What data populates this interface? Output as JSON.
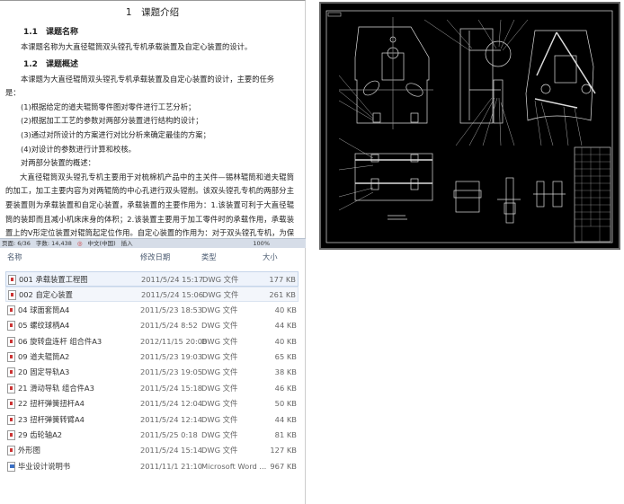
{
  "document": {
    "h1": "1　课题介绍",
    "h2a": "1.1　课题名称",
    "p_name": "本课题名称为大直径辊筒双头镗孔专机承载装置及自定心装置的设计。",
    "h2b": "1.2　课题概述",
    "p_intro1": "本课题为大直径辊筒双头镗孔专机承载装置及自定心装置的设计，主要的任务",
    "p_intro2": "是：",
    "tasks": [
      "(1)根据给定的道夫辊筒零件图对零件进行工艺分析；",
      "(2)根据加工工艺的参数对两部分装置进行结构的设计；",
      "(3)通过对所设计的方案进行对比分析来确定最佳的方案；",
      "(4)对设计的参数进行计算和校核。"
    ],
    "p_overview": "对两部分装置的概述：",
    "p_body": "大直径辊筒双头镗孔专机主要用于对梳棉机产品中的主关件—锡林辊筒和道夫辊筒的加工，加工主要内容为对两辊筒的中心孔进行双头镗削。该双头镗孔专机的两部分主要装置则为承载装置和自定心装置，承载装置的主要作用为：1.该装置可利于大直径辊筒的装卸而且减小机床床身的体积；2.该装置主要用于加工零件时的承载作用，承载装置上的V形定位装置对辊筒起定位作用。自定心装置的作用为：对于双头镗孔专机，为保证镗孔的精度和辊筒两端孔的同轴度就必须保证在加工时"
  },
  "statusbar": {
    "page": "页面: 6/36",
    "words": "字数: 14,438",
    "lang": "中文(中国)",
    "mode": "插入",
    "zoom": "100%"
  },
  "explorer": {
    "columns": {
      "name": "名称",
      "date": "修改日期",
      "type": "类型",
      "size": "大小"
    },
    "files": [
      {
        "name": "001 承载装置工程图",
        "date": "2011/5/24 15:17",
        "type": "DWG 文件",
        "size": "177 KB",
        "icon": "dwg-file-icon"
      },
      {
        "name": "002 自定心装置",
        "date": "2011/5/24 15:06",
        "type": "DWG 文件",
        "size": "261 KB",
        "icon": "dwg-file-icon"
      },
      {
        "name": "04 球面套筒A4",
        "date": "2011/5/23 18:53",
        "type": "DWG 文件",
        "size": "40 KB",
        "icon": "dwg-file-icon"
      },
      {
        "name": "05 螺纹球柄A4",
        "date": "2011/5/24 8:52",
        "type": "DWG 文件",
        "size": "44 KB",
        "icon": "dwg-file-icon"
      },
      {
        "name": "06 旋转盘连杆 组合件A3",
        "date": "2012/11/15 20:08",
        "type": "DWG 文件",
        "size": "40 KB",
        "icon": "dwg-file-icon"
      },
      {
        "name": "09 道夫辊筒A2",
        "date": "2011/5/23 19:03",
        "type": "DWG 文件",
        "size": "65 KB",
        "icon": "dwg-file-icon"
      },
      {
        "name": "20 固定导轨A3",
        "date": "2011/5/23 19:05",
        "type": "DWG 文件",
        "size": "38 KB",
        "icon": "dwg-file-icon"
      },
      {
        "name": "21 滑动导轨 组合件A3",
        "date": "2011/5/24 15:18",
        "type": "DWG 文件",
        "size": "46 KB",
        "icon": "dwg-file-icon"
      },
      {
        "name": "22 扭杆弹簧扭杆A4",
        "date": "2011/5/24 12:04",
        "type": "DWG 文件",
        "size": "50 KB",
        "icon": "dwg-file-icon"
      },
      {
        "name": "23 扭杆弹簧转臂A4",
        "date": "2011/5/24 12:14",
        "type": "DWG 文件",
        "size": "44 KB",
        "icon": "dwg-file-icon"
      },
      {
        "name": "29 齿轮轴A2",
        "date": "2011/5/25 0:18",
        "type": "DWG 文件",
        "size": "81 KB",
        "icon": "dwg-file-icon"
      },
      {
        "name": "外形图",
        "date": "2011/5/24 15:14",
        "type": "DWG 文件",
        "size": "127 KB",
        "icon": "dwg-file-icon"
      },
      {
        "name": "毕业设计说明书",
        "date": "2011/11/1 21:10",
        "type": "Microsoft Word ...",
        "size": "967 KB",
        "icon": "word-file-icon"
      }
    ]
  }
}
